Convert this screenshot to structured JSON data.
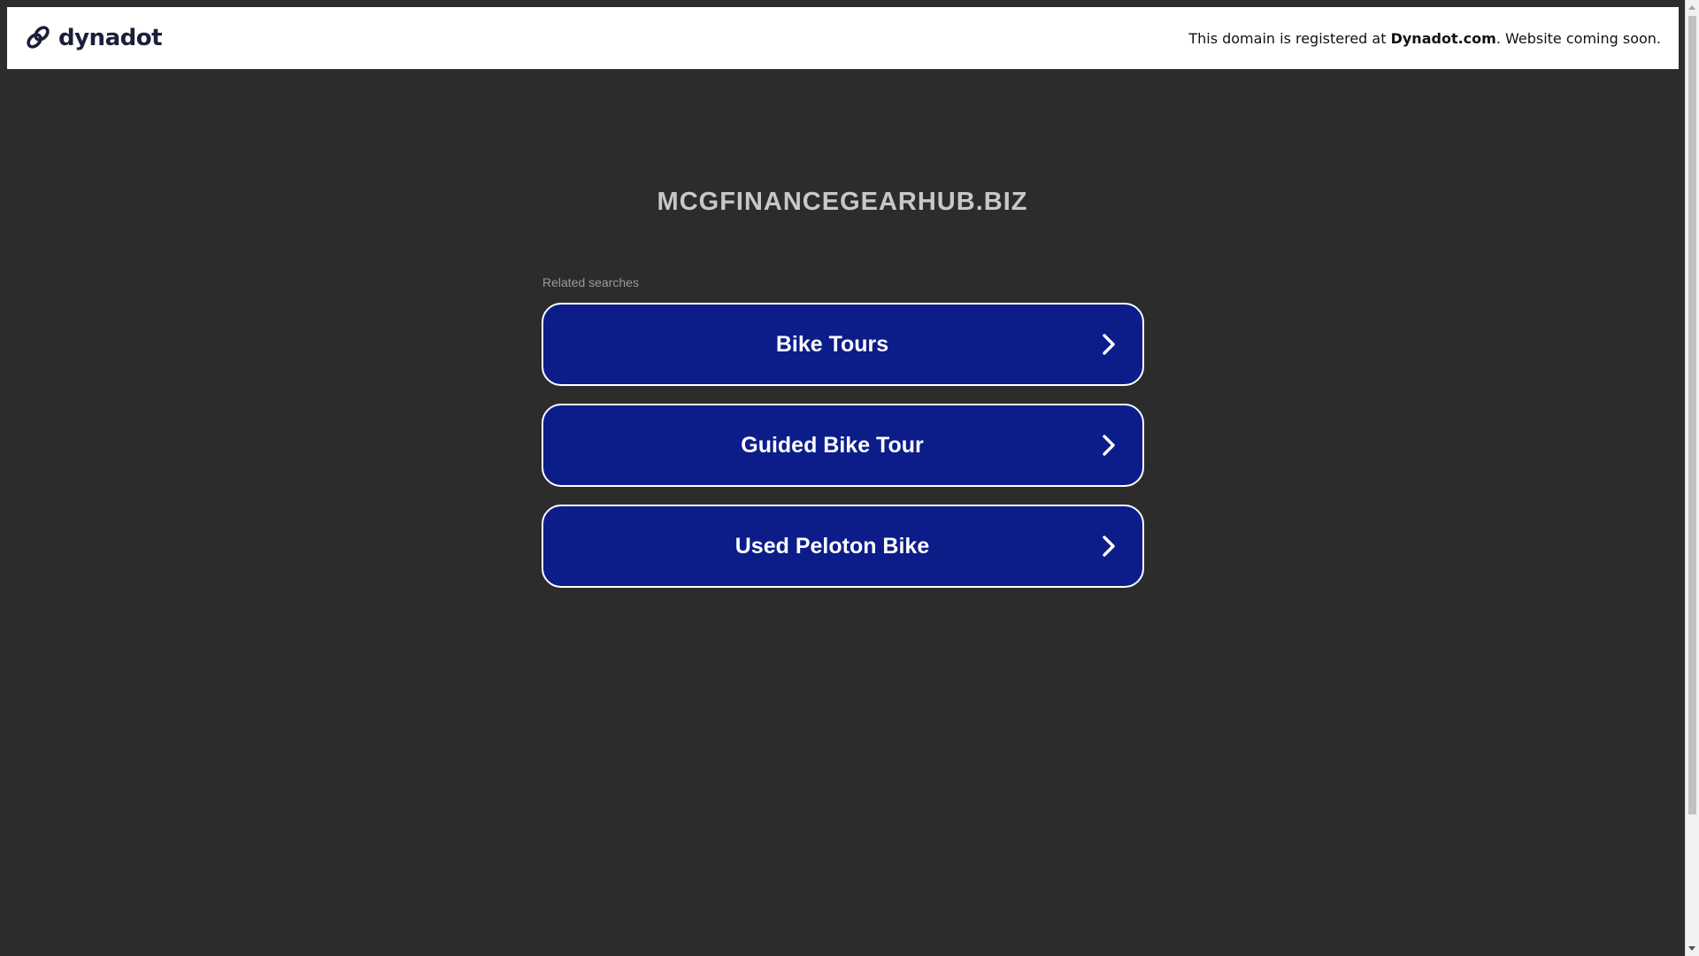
{
  "header": {
    "logo_text": "dynadot",
    "logo_icon": "dynadot-link-icon",
    "notice_prefix": "This domain is registered at ",
    "notice_brand": "Dynadot.com",
    "notice_suffix": ". Website coming soon."
  },
  "main": {
    "domain": "MCGFINANCEGEARHUB.BIZ",
    "related_label": "Related searches",
    "results": [
      {
        "label": "Bike Tours",
        "icon": "chevron-right-icon"
      },
      {
        "label": "Guided Bike Tour",
        "icon": "chevron-right-icon"
      },
      {
        "label": "Used Peloton Bike",
        "icon": "chevron-right-icon"
      }
    ]
  },
  "colors": {
    "background": "#2c2c2c",
    "button_bg": "#0c1d8a",
    "button_border": "#ffffff",
    "title": "#c8c8c8",
    "logo": "#1b1f3b"
  }
}
